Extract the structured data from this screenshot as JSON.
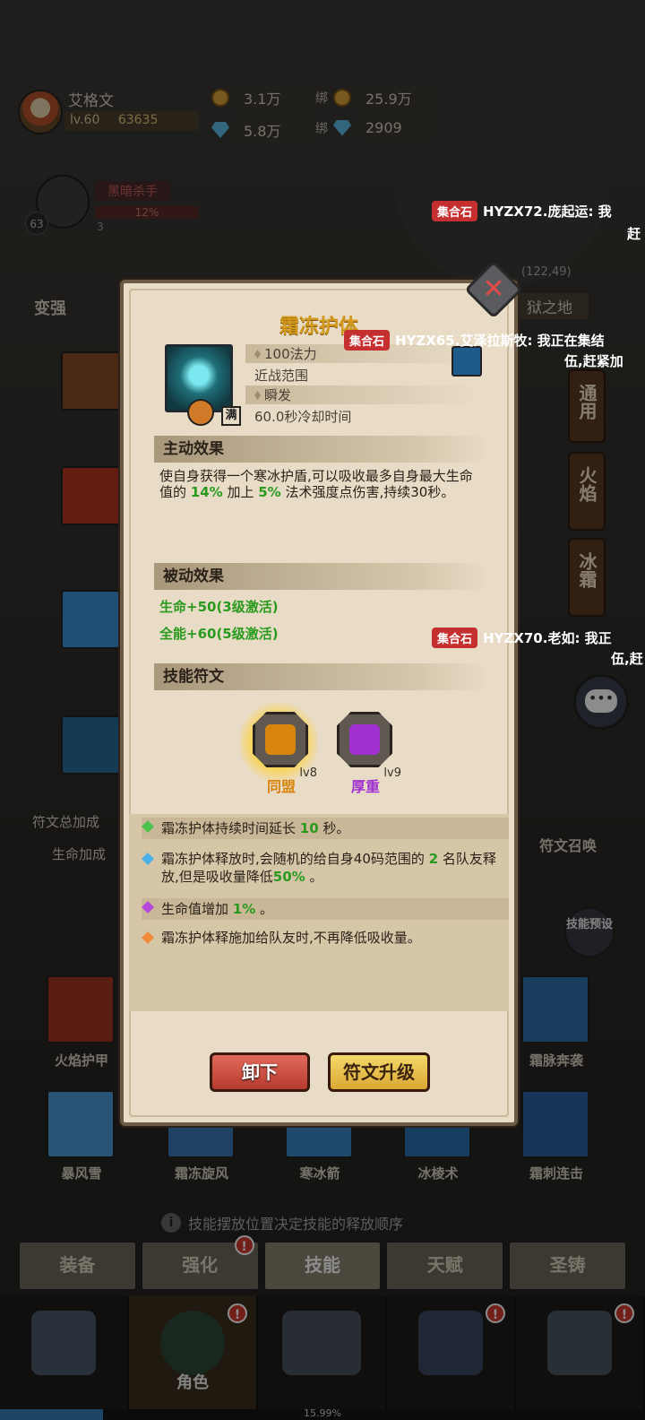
{
  "player": {
    "name": "艾格文",
    "level": "lv.60",
    "power": "63635",
    "gold": "3.1万",
    "diamonds": "5.8万",
    "bound_label": "绑",
    "bound_gold": "25.9万",
    "bound_diamonds": "2909"
  },
  "boss": {
    "name": "黑暗杀手",
    "progress": "12%",
    "level": "63",
    "sub": "3"
  },
  "left_side": {
    "strengthen": "变强",
    "rune_total": "符文总加成",
    "life_bonus": "生命加成"
  },
  "map": {
    "coord": "(122,49)",
    "name": "狱之地"
  },
  "chat": [
    {
      "tag": "集合石",
      "text": "HYZX72.庞起运: 我",
      "text2": "赶"
    },
    {
      "tag": "集合石",
      "text": "HYZX65.艾泽拉斯牧: 我正在集结",
      "text2": "伍,赶紧加"
    },
    {
      "tag": "集合石",
      "text": "HYZX70.老如: 我正",
      "text2": "伍,赶"
    }
  ],
  "right_tabs": [
    "通用",
    "火焰",
    "冰霜"
  ],
  "right_side": {
    "chat_icon": "speech-bubble-icon",
    "rune_summon": "符文召唤",
    "preset": "技能预设"
  },
  "dialog": {
    "title": "霜冻护体",
    "mana": "100法力",
    "range": "近战范围",
    "cast": "瞬发",
    "cooldown": "60.0秒冷却时间",
    "full_badge": "满",
    "active_header": "主动效果",
    "active_desc": {
      "p1": "使自身获得一个寒冰护盾,可以吸收最多自身最大生命值的 ",
      "v1": "14%",
      "p2": " 加上 ",
      "v2": "5%",
      "p3": " 法术强度点伤害,持续30秒。"
    },
    "passive_header": "被动效果",
    "passives": [
      "生命+50(3级激活)",
      "全能+60(5级激活)"
    ],
    "rune_header": "技能符文",
    "runes": [
      {
        "name": "同盟",
        "level": "lv8",
        "color": "#d8850f"
      },
      {
        "name": "厚重",
        "level": "lv9",
        "color": "#a030d0"
      }
    ],
    "bonuses": [
      {
        "color": "#4ec24e",
        "p1": "霜冻护体持续时间延长 ",
        "v1": "10",
        "p2": " 秒。"
      },
      {
        "color": "#4ab0e8",
        "p1": "霜冻护体释放时,会随机的给自身40码范围的 ",
        "v1": "2",
        "p2": " 名队友释放,但是吸收量降低",
        "v2": "50%",
        "p3": " 。"
      },
      {
        "color": "#b54ad8",
        "p1": "生命值增加 ",
        "v1": "1%",
        "p2": " 。"
      },
      {
        "color": "#f08a3a",
        "p1": "霜冻护体释施加给队友时,不再降低吸收量。"
      }
    ],
    "btn_unload": "卸下",
    "btn_upgrade": "符文升级"
  },
  "skills_bar": [
    "火焰护甲",
    "霜脉奔袭",
    "暴风雪",
    "霜冻旋风",
    "寒冰箭",
    "冰棱术",
    "霜刺连击"
  ],
  "hint": "技能摆放位置决定技能的释放顺序",
  "subtabs": [
    "装备",
    "强化",
    "技能",
    "天赋",
    "圣铸"
  ],
  "nav": {
    "role": "角色"
  },
  "progress": {
    "value": 0.1599,
    "label": "15.99%"
  }
}
